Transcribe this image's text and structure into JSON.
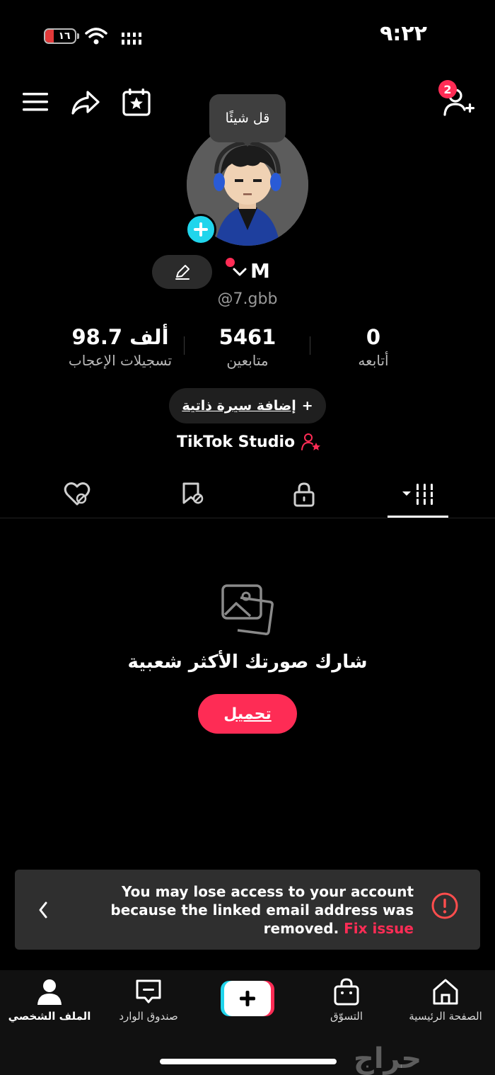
{
  "status_bar": {
    "time": "٩:٢٢",
    "battery_level": "١٦"
  },
  "header": {
    "friend_requests_count": "2",
    "say_something_tooltip": "قل شيئًا"
  },
  "profile": {
    "name": "M",
    "username": "@7.gbb",
    "stats": [
      {
        "value": "98.7 ألف",
        "label": "تسجيلات الإعجاب"
      },
      {
        "value": "5461",
        "label": "متابعين"
      },
      {
        "value": "0",
        "label": "أتابعه"
      }
    ],
    "add_bio_label": "إضافة سيرة ذاتية",
    "add_bio_plus": "+",
    "studio_label": "TikTok Studio"
  },
  "empty_state": {
    "title": "شارك صورتك الأكثر شعبية",
    "upload_label": "تحميل"
  },
  "banner": {
    "message": "You may lose access to your account because the linked email address was removed.",
    "fix_label": "Fix issue"
  },
  "bottom_nav": {
    "profile": "الملف الشخصي",
    "inbox": "صندوق الوارد",
    "create": "+",
    "shop": "التسوّق",
    "home": "الصفحة الرئيسية"
  },
  "watermark": "حراج",
  "colors": {
    "accent": "#fe2c55",
    "cyan": "#20d5ec",
    "banner_bg": "#2f2f2f"
  }
}
